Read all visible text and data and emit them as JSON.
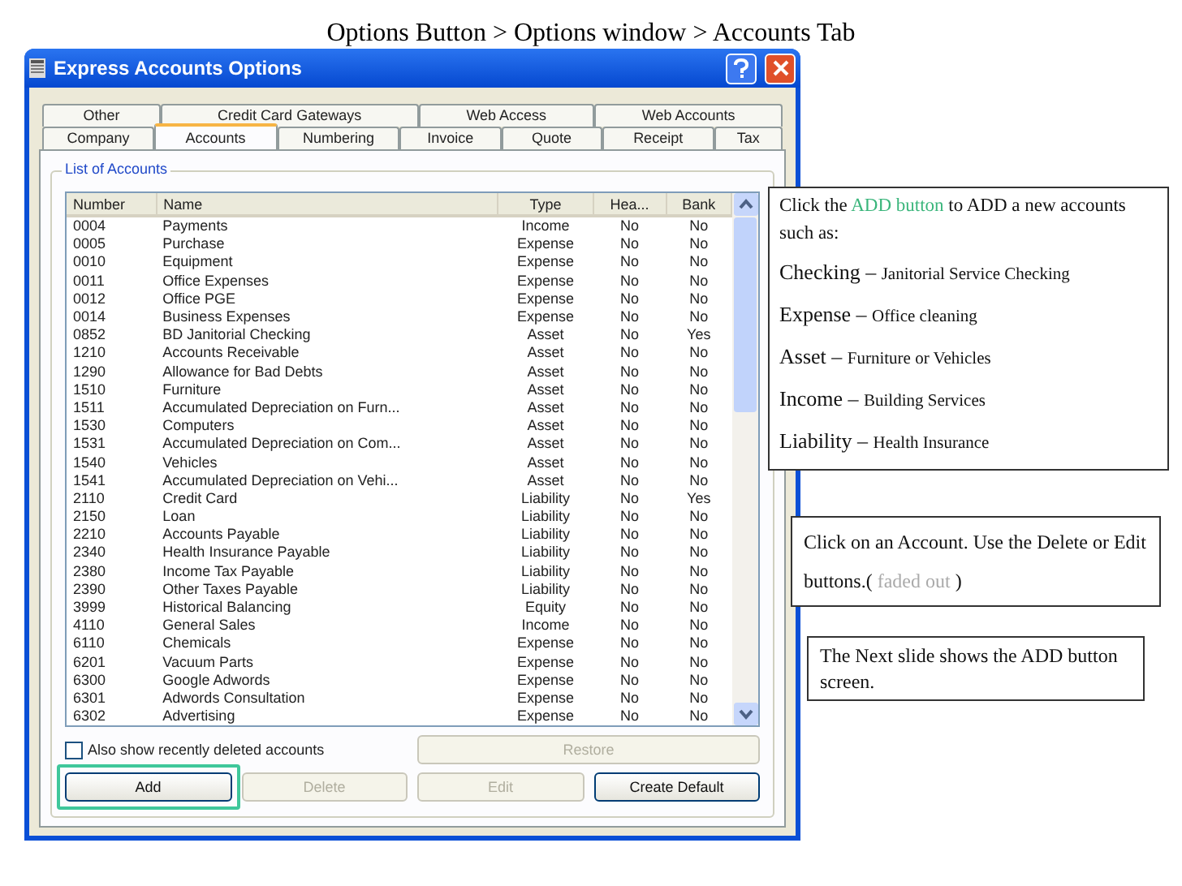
{
  "slide_title": "Options Button > Options window > Accounts Tab",
  "window": {
    "title": "Express Accounts Options"
  },
  "tabs_row_1": [
    {
      "label": "Other",
      "selected": false
    },
    {
      "label": "Credit Card Gateways",
      "selected": false
    },
    {
      "label": "Web Access",
      "selected": false
    },
    {
      "label": "Web Accounts",
      "selected": false
    }
  ],
  "tabs_row_2": [
    {
      "label": "Company",
      "selected": false
    },
    {
      "label": "Accounts",
      "selected": true
    },
    {
      "label": "Numbering",
      "selected": false
    },
    {
      "label": "Invoice",
      "selected": false
    },
    {
      "label": "Quote",
      "selected": false
    },
    {
      "label": "Receipt",
      "selected": false
    },
    {
      "label": "Tax",
      "selected": false
    }
  ],
  "group_title": "List of Accounts",
  "table": {
    "columns": [
      "Number",
      "Name",
      "Type",
      "Hea...",
      "Bank"
    ],
    "rows": [
      [
        "0004",
        "Payments",
        "Income",
        "No",
        "No"
      ],
      [
        "0005",
        "Purchase",
        "Expense",
        "No",
        "No"
      ],
      [
        "0010",
        "Equipment",
        "Expense",
        "No",
        "No"
      ],
      [
        "0011",
        "Office Expenses",
        "Expense",
        "No",
        "No"
      ],
      [
        "0012",
        "Office PGE",
        "Expense",
        "No",
        "No"
      ],
      [
        "0014",
        "Business Expenses",
        "Expense",
        "No",
        "No"
      ],
      [
        "0852",
        "BD Janitorial Checking",
        "Asset",
        "No",
        "Yes"
      ],
      [
        "1210",
        "Accounts Receivable",
        "Asset",
        "No",
        "No"
      ],
      [
        "1290",
        "Allowance for Bad Debts",
        "Asset",
        "No",
        "No"
      ],
      [
        "1510",
        "Furniture",
        "Asset",
        "No",
        "No"
      ],
      [
        "1511",
        "Accumulated Depreciation on Furn...",
        "Asset",
        "No",
        "No"
      ],
      [
        "1530",
        "Computers",
        "Asset",
        "No",
        "No"
      ],
      [
        "1531",
        "Accumulated Depreciation on Com...",
        "Asset",
        "No",
        "No"
      ],
      [
        "1540",
        "Vehicles",
        "Asset",
        "No",
        "No"
      ],
      [
        "1541",
        "Accumulated Depreciation on Vehi...",
        "Asset",
        "No",
        "No"
      ],
      [
        "2110",
        "Credit Card",
        "Liability",
        "No",
        "Yes"
      ],
      [
        "2150",
        "Loan",
        "Liability",
        "No",
        "No"
      ],
      [
        "2210",
        "Accounts Payable",
        "Liability",
        "No",
        "No"
      ],
      [
        "2340",
        "Health Insurance Payable",
        "Liability",
        "No",
        "No"
      ],
      [
        "2380",
        "Income Tax Payable",
        "Liability",
        "No",
        "No"
      ],
      [
        "2390",
        "Other Taxes Payable",
        "Liability",
        "No",
        "No"
      ],
      [
        "3999",
        "Historical Balancing",
        "Equity",
        "No",
        "No"
      ],
      [
        "4110",
        "General Sales",
        "Income",
        "No",
        "No"
      ],
      [
        "6110",
        "Chemicals",
        "Expense",
        "No",
        "No"
      ],
      [
        "6201",
        "Vacuum Parts",
        "Expense",
        "No",
        "No"
      ],
      [
        "6300",
        "Google Adwords",
        "Expense",
        "No",
        "No"
      ],
      [
        "6301",
        "Adwords Consultation",
        "Expense",
        "No",
        "No"
      ],
      [
        "6302",
        "Advertising",
        "Expense",
        "No",
        "No"
      ]
    ]
  },
  "show_deleted": {
    "label": "Also show recently deleted accounts",
    "checked": false
  },
  "restore_button": {
    "label": "Restore",
    "disabled": true
  },
  "buttons": [
    {
      "label": "Add",
      "disabled": false,
      "highlighted": true
    },
    {
      "label": "Delete",
      "disabled": true,
      "highlighted": false
    },
    {
      "label": "Edit",
      "disabled": true,
      "highlighted": false
    },
    {
      "label": "Create Default",
      "disabled": false,
      "highlighted": false
    }
  ],
  "callout_add": {
    "intro": [
      {
        "kind": "plain",
        "text": "Click the "
      },
      {
        "kind": "highlight",
        "text": "ADD button"
      },
      {
        "kind": "plain",
        "text": " to ADD a new accounts such as:"
      }
    ],
    "items": [
      {
        "term": "Checking –",
        "example": "Janitorial Service Checking"
      },
      {
        "term": "Expense –",
        "example": "Office cleaning"
      },
      {
        "term": "Asset –",
        "example": "Furniture or Vehicles"
      },
      {
        "term": "Income –",
        "example": "Building Services"
      },
      {
        "term": "Liability –",
        "example": "Health Insurance"
      }
    ]
  },
  "callout_edit": [
    {
      "kind": "plain",
      "text": "Click on an Account. Use the Delete or Edit buttons.( "
    },
    {
      "kind": "faded",
      "text": "faded out"
    },
    {
      "kind": "plain",
      "text": " )"
    }
  ],
  "callout_next": [
    {
      "kind": "plain",
      "text": "The Next slide shows the ADD button screen."
    }
  ]
}
